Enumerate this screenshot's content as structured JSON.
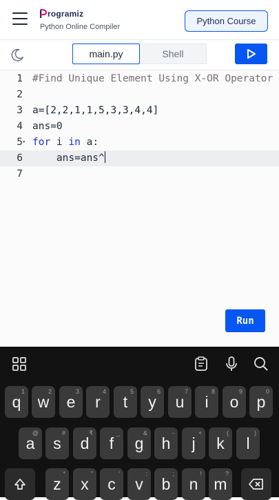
{
  "header": {
    "logo": "rogramiz",
    "subtitle": "Python Online Compiler",
    "course_button": "Python Course"
  },
  "toolbar": {
    "tab_main": "main.py",
    "tab_shell": "Shell"
  },
  "editor": {
    "line_numbers": [
      "1",
      "2",
      "3",
      "4",
      "5",
      "6",
      "7"
    ],
    "lines": [
      "#Find Unique Element Using X-OR Operator",
      "",
      "a=[2,2,1,1,5,3,3,4,4]",
      "ans=0",
      "for i in a:",
      "    ans=ans^",
      ""
    ],
    "run_label": "Run"
  },
  "keyboard": {
    "row1": [
      {
        "k": "q",
        "s": "1"
      },
      {
        "k": "w",
        "s": "2"
      },
      {
        "k": "e",
        "s": "3"
      },
      {
        "k": "r",
        "s": "4"
      },
      {
        "k": "t",
        "s": "5"
      },
      {
        "k": "y",
        "s": "6"
      },
      {
        "k": "u",
        "s": "7"
      },
      {
        "k": "i",
        "s": "8"
      },
      {
        "k": "o",
        "s": "9"
      },
      {
        "k": "p",
        "s": "0"
      }
    ],
    "row2": [
      {
        "k": "a",
        "s": "@"
      },
      {
        "k": "s",
        "s": "#"
      },
      {
        "k": "d",
        "s": "₹"
      },
      {
        "k": "f",
        "s": "_"
      },
      {
        "k": "g",
        "s": "&"
      },
      {
        "k": "h",
        "s": "-"
      },
      {
        "k": "j",
        "s": "+"
      },
      {
        "k": "k",
        "s": "("
      },
      {
        "k": "l",
        "s": ")"
      }
    ],
    "row3": [
      {
        "k": "z",
        "s": "*"
      },
      {
        "k": "x",
        "s": "\""
      },
      {
        "k": "c",
        "s": "'"
      },
      {
        "k": "v",
        "s": ":"
      },
      {
        "k": "b",
        "s": ";"
      },
      {
        "k": "n",
        "s": "!"
      },
      {
        "k": "m",
        "s": "?"
      }
    ]
  },
  "colors": {
    "accent": "#0556f3",
    "keyword": "#1a32c7",
    "keyboard_bg": "#121212",
    "key_bg": "#3a3a3a"
  }
}
